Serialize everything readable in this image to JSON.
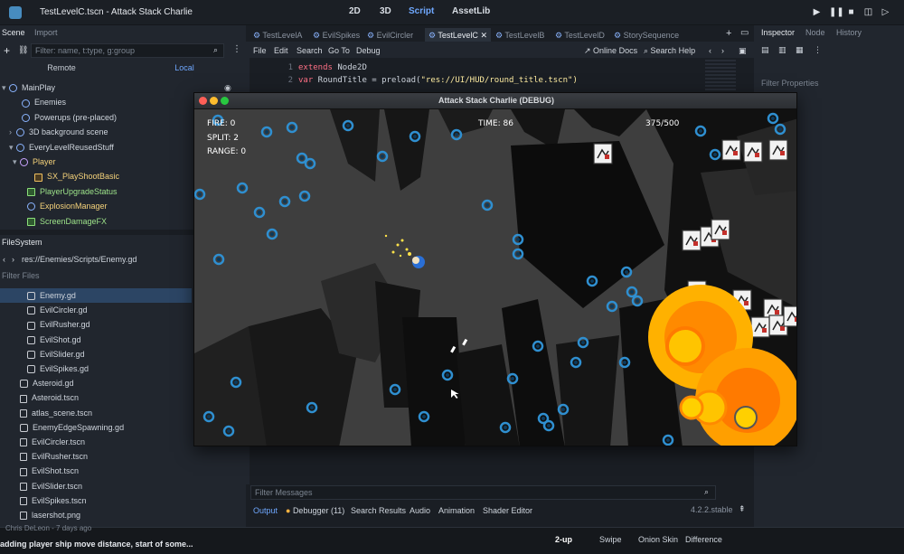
{
  "window": {
    "title": "TestLevelC.tscn - Attack Stack Charlie",
    "views": [
      "2D",
      "3D",
      "Script",
      "AssetLib"
    ],
    "active_view": "Script"
  },
  "scene_dock": {
    "tabs": [
      "Scene",
      "Import"
    ],
    "filter_placeholder": "Filter: name, t:type, g:group",
    "remote_label": "Remote",
    "local_label": "Local",
    "tree": [
      {
        "label": "MainPlay",
        "icon": "node-icon",
        "color": "#cfd5dd"
      },
      {
        "label": "Enemies",
        "icon": "node-icon",
        "color": "#cfd5dd"
      },
      {
        "label": "Powerups (pre-placed)",
        "icon": "node-icon",
        "color": "#cfd5dd"
      },
      {
        "label": "3D background scene",
        "icon": "node-icon",
        "color": "#cfd5dd"
      },
      {
        "label": "EveryLevelReusedStuff",
        "icon": "node-icon",
        "color": "#cfd5dd"
      },
      {
        "label": "Player",
        "icon": "character-icon",
        "color": "#f5d27a"
      },
      {
        "label": "SX_PlayShootBasic",
        "icon": "audio-icon",
        "color": "#f5d27a"
      },
      {
        "label": "PlayerUpgradeStatus",
        "icon": "control-icon",
        "color": "#9ee48a"
      },
      {
        "label": "ExplosionManager",
        "icon": "node-icon",
        "color": "#f5d27a"
      },
      {
        "label": "ScreenDamageFX",
        "icon": "control-icon",
        "color": "#9ee48a"
      }
    ]
  },
  "filesystem_dock": {
    "tab": "FileSystem",
    "path": "res://Enemies/Scripts/Enemy.gd",
    "filter_placeholder": "Filter Files",
    "files": [
      {
        "label": "Enemy.gd",
        "type": "script",
        "selected": true
      },
      {
        "label": "EvilCircler.gd",
        "type": "script"
      },
      {
        "label": "EvilRusher.gd",
        "type": "script"
      },
      {
        "label": "EvilShot.gd",
        "type": "script"
      },
      {
        "label": "EvilSlider.gd",
        "type": "script"
      },
      {
        "label": "EvilSpikes.gd",
        "type": "script"
      },
      {
        "label": "Asteroid.gd",
        "type": "script"
      },
      {
        "label": "Asteroid.tscn",
        "type": "scene"
      },
      {
        "label": "atlas_scene.tscn",
        "type": "scene"
      },
      {
        "label": "EnemyEdgeSpawning.gd",
        "type": "script"
      },
      {
        "label": "EvilCircler.tscn",
        "type": "scene"
      },
      {
        "label": "EvilRusher.tscn",
        "type": "scene"
      },
      {
        "label": "EvilShot.tscn",
        "type": "scene"
      },
      {
        "label": "EvilSlider.tscn",
        "type": "scene"
      },
      {
        "label": "EvilSpikes.tscn",
        "type": "scene"
      },
      {
        "label": "lasershot.png",
        "type": "image"
      }
    ]
  },
  "script_editor": {
    "tabs": [
      "TestLevelA",
      "EvilSpikes",
      "EvilCircler",
      "TestLevelC",
      "TestLevelB",
      "TestLevelD",
      "StorySequence"
    ],
    "active_tab": "TestLevelC",
    "menu": [
      "File",
      "Edit",
      "Search",
      "Go To",
      "Debug"
    ],
    "online_docs": "Online Docs",
    "search_help": "Search Help",
    "code_lines": [
      {
        "n": "1",
        "kw": "extends",
        "rest": " Node2D",
        "str": ""
      },
      {
        "n": "2",
        "kw": "var",
        "rest": " RoundTitle = preload(",
        "str": "\"res://UI/HUD/round_title.tscn\")"
      }
    ],
    "filter_messages": "Filter Messages",
    "bottom_tabs": [
      "Output",
      "Debugger (11)",
      "Search Results",
      "Audio",
      "Animation",
      "Shader Editor"
    ],
    "version": "4.2.2.stable"
  },
  "inspector": {
    "tabs": [
      "Inspector",
      "Node",
      "History"
    ],
    "filter_placeholder": "Filter Properties"
  },
  "game_window": {
    "title": "Attack Stack Charlie (DEBUG)",
    "hud_fire": "FIRE: 0",
    "hud_split": "SPLIT: 2",
    "hud_range": "RANGE: 0",
    "hud_time": "TIME: 86",
    "hud_score": "375/500"
  },
  "bottom_bar": {
    "commit_author": "Chris DeLeon - 7 days ago",
    "commit_message": "adding player ship move distance, start of some...",
    "buttons": [
      "2-up",
      "Swipe",
      "Onion Skin",
      "Difference"
    ]
  },
  "colors": {
    "accent": "#6fa8ff",
    "node_yellow": "#f5d27a",
    "node_green": "#9ee48a",
    "keyword": "#ff7085",
    "string": "#ffeda1"
  }
}
